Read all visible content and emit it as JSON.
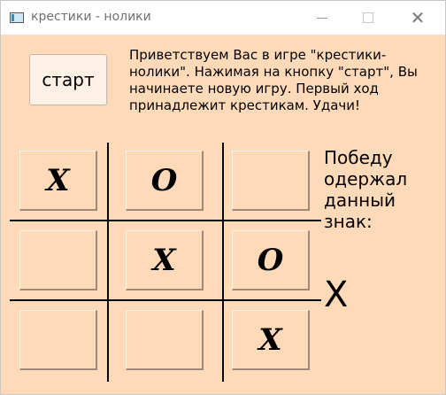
{
  "window": {
    "title": "крестики - нолики"
  },
  "controls": {
    "start_label": "старт"
  },
  "welcome_text": "Приветствуем Вас в игре \"крестики-нолики\". Нажимая на кнопку \"старт\", Вы начинаете новую игру. Первый ход принадлежит крестикам. Удачи!",
  "board": {
    "cells": [
      "X",
      "O",
      "",
      "",
      "X",
      "O",
      "",
      "",
      "X"
    ]
  },
  "winner": {
    "caption": "Победу одержал данный знак:",
    "mark": "X"
  },
  "icons": {
    "app": "window-app-icon",
    "minimize": "minimize-icon",
    "maximize": "maximize-icon",
    "close": "close-icon"
  },
  "colors": {
    "background": "#ffdab9",
    "button": "#fdf1e6"
  }
}
